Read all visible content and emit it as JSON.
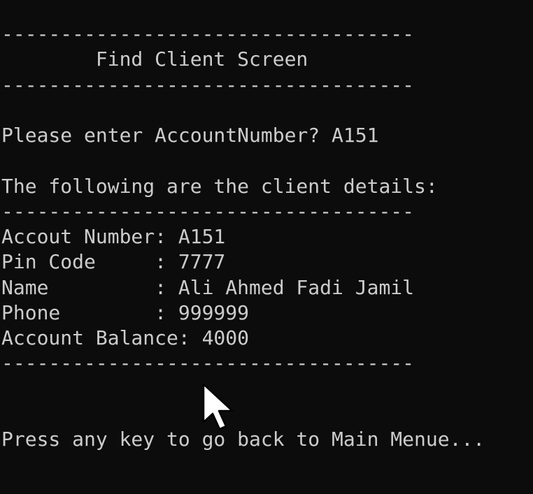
{
  "screen": {
    "divider_top": "-----------------------------------",
    "title": "        Find Client Screen",
    "divider_title_bottom": "-----------------------------------",
    "prompt": "Please enter AccountNumber? A151",
    "details_heading": "The following are the client details:",
    "divider_details_top": "-----------------------------------",
    "fields": [
      {
        "text": "Accout Number: A151"
      },
      {
        "text": "Pin Code     : 7777"
      },
      {
        "text": "Name         : Ali Ahmed Fadi Jamil"
      },
      {
        "text": "Phone        : 999999"
      },
      {
        "text": "Account Balance: 4000"
      }
    ],
    "divider_details_bottom": "-----------------------------------",
    "footer": "Press any key to go back to Main Menue..."
  },
  "colors": {
    "background": "#0c0c0c",
    "text": "#cccccc"
  },
  "icons": {
    "cursor": "mouse-pointer-icon"
  }
}
